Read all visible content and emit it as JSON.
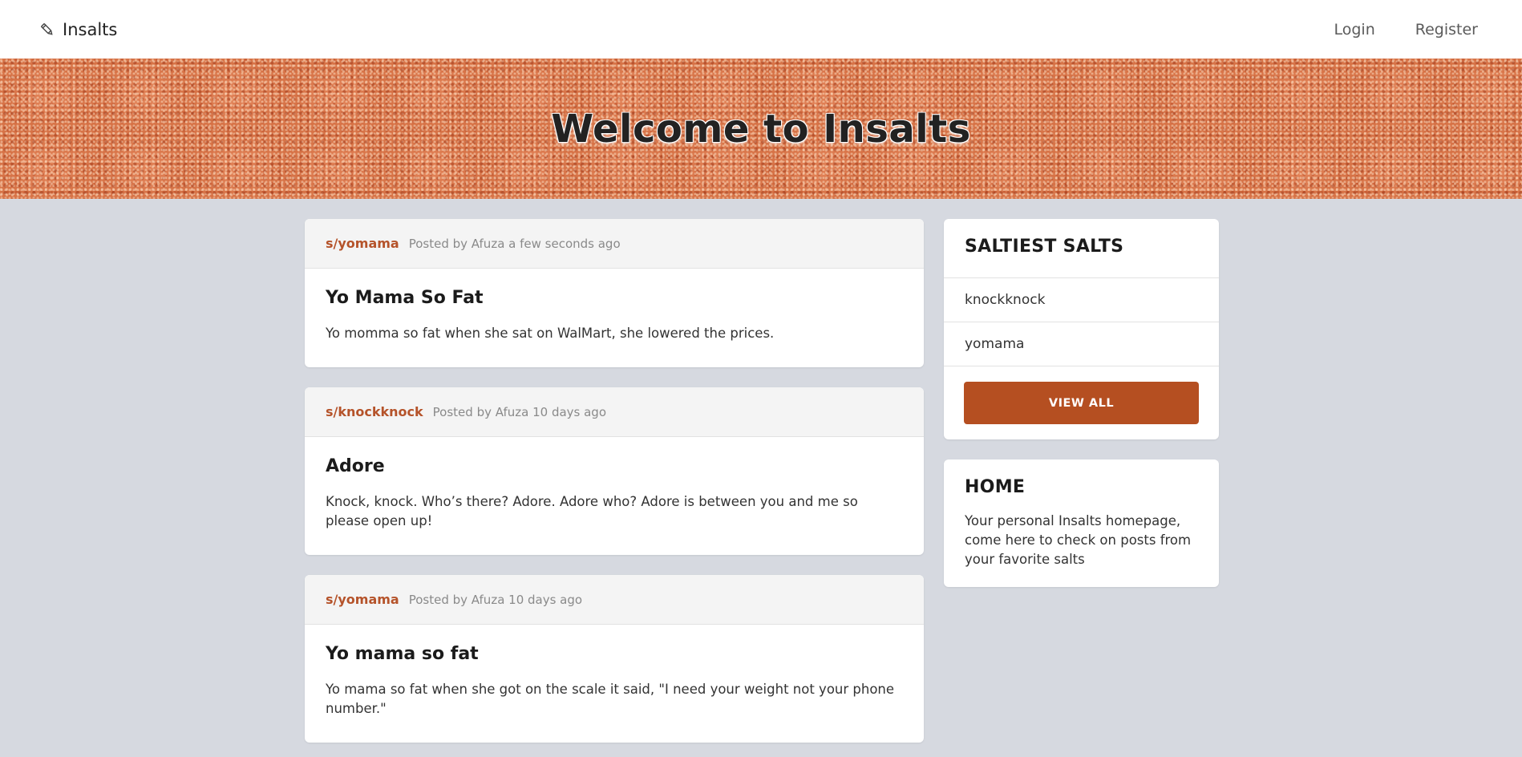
{
  "navbar": {
    "brand": "Insalts",
    "login": "Login",
    "register": "Register"
  },
  "hero": {
    "title": "Welcome to Insalts"
  },
  "posts": [
    {
      "sub": "s/yomama",
      "meta": "Posted by Afuza a few seconds ago",
      "title": "Yo Mama So Fat",
      "body": "Yo momma so fat when she sat on WalMart, she lowered the prices."
    },
    {
      "sub": "s/knockknock",
      "meta": "Posted by Afuza 10 days ago",
      "title": "Adore",
      "body": "Knock, knock. Who’s there? Adore. Adore who? Adore is between you and me so please open up!"
    },
    {
      "sub": "s/yomama",
      "meta": "Posted by Afuza 10 days ago",
      "title": "Yo mama so fat",
      "body": "Yo mama so fat when she got on the scale it said, \"I need your weight not your phone number.\""
    }
  ],
  "saltiest": {
    "title": "SALTIEST SALTS",
    "items": [
      "knockknock",
      "yomama"
    ],
    "view_all": "VIEW ALL"
  },
  "home": {
    "title": "HOME",
    "text": "Your personal Insalts homepage, come here to check on posts from your favorite salts"
  },
  "colors": {
    "accent": "#b54f21",
    "background": "#d6d9e0",
    "hero": "#d77347"
  },
  "icons": {
    "brand": "pencil-icon"
  }
}
